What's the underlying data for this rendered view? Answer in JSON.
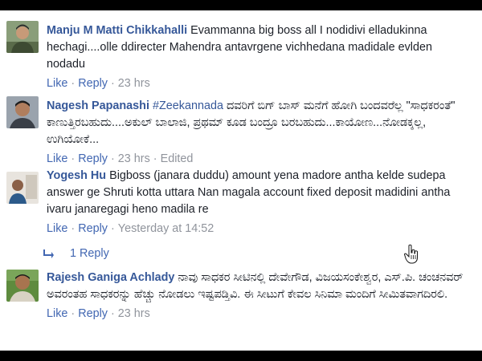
{
  "actions": {
    "like": "Like",
    "reply": "Reply",
    "dot": "·"
  },
  "comments": [
    {
      "author": "Manju M Matti Chikkahalli",
      "text": "Evammanna big boss all I nodidivi elladukinna hechagi....olle ddirecter Mahendra antavrgene vichhedana madidale evlden nodadu",
      "time": "23 hrs"
    },
    {
      "author": "Nagesh Papanashi",
      "tag": "#Zeekannada",
      "text": "ದವರಿಗೆ ಬಿಗ್ ಬಾಸ್ ಮನೆಗೆ ಹೋಗಿ ಬಂದವರೆಲ್ಲ \"ಸಾಧಕರಂತೆ\" ಕಾಣುತ್ತಿರಬಹುದು....ಅಕುಲ್ ಬಾಲಾಜಿ, ಪ್ರಥಮ್ ಕೂಡ ಬಂದ್ರೂ ಬರಬಹುದು...ಕಾಯೋಣ...ನೋಡಕ್ಕಲ್ಲ, ಉಗಿಯೋಕೆ...",
      "time": "23 hrs",
      "edited": "Edited"
    },
    {
      "author": "Yogesh Hu",
      "text": "Bigboss (janara duddu) amount yena madore antha kelde sudepa answer ge Shruti kotta uttara Nan magala account fixed deposit madidini antha ivaru janaregagi heno madila re",
      "time": "Yesterday at 14:52",
      "replies": "1 Reply"
    },
    {
      "author": "Rajesh Ganiga Achlady",
      "text": "ನಾವು ಸಾಧಕರ ಸೀಟಿನಲ್ಲಿ ದೇವೇಗೌಡ, ವಿಜಯಸಂಕೇಶ್ವರ, ಎಸ್.ಪಿ. ಚಂಚನವರ್ ಅವರಂತಹ ಸಾಧಕರನ್ನು ಹೆಚ್ಚು ನೋಡಲು ಇಷ್ಟಪಡ್ತಿವಿ. ಈ ಸೀಟುಗೆ ಕೇವಲ ಸಿನಿಮಾ ಮಂದಿಗೆ ಸೀಮಿತವಾಗದಿರಲಿ.",
      "time": "23 hrs"
    }
  ],
  "colors": {
    "name": "#365899",
    "link": "#4267b2",
    "meta": "#90949c",
    "text": "#1d2129"
  }
}
